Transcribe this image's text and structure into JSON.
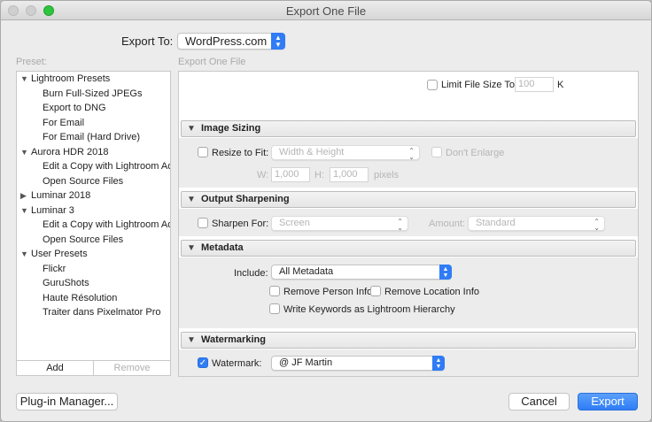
{
  "window": {
    "title": "Export One File"
  },
  "export_to": {
    "label": "Export To:",
    "value": "WordPress.com"
  },
  "presets": {
    "heading": "Preset:",
    "items": [
      {
        "type": "folder",
        "expanded": true,
        "label": "Lightroom Presets"
      },
      {
        "type": "child",
        "label": "Burn Full-Sized JPEGs"
      },
      {
        "type": "child",
        "label": "Export to DNG"
      },
      {
        "type": "child",
        "label": "For Email"
      },
      {
        "type": "child",
        "label": "For Email (Hard Drive)"
      },
      {
        "type": "folder",
        "expanded": true,
        "label": "Aurora HDR 2018"
      },
      {
        "type": "child",
        "label": "Edit a Copy with Lightroom Adju"
      },
      {
        "type": "child",
        "label": "Open Source Files"
      },
      {
        "type": "folder",
        "expanded": false,
        "label": "Luminar 2018"
      },
      {
        "type": "folder",
        "expanded": true,
        "label": "Luminar 3"
      },
      {
        "type": "child",
        "label": "Edit a Copy with Lightroom Adju"
      },
      {
        "type": "child",
        "label": "Open Source Files"
      },
      {
        "type": "folder",
        "expanded": true,
        "label": "User Presets"
      },
      {
        "type": "child",
        "label": "Flickr"
      },
      {
        "type": "child",
        "label": "GuruShots"
      },
      {
        "type": "child",
        "label": "Haute Résolution"
      },
      {
        "type": "child",
        "label": "Traiter dans Pixelmator Pro"
      }
    ],
    "add_label": "Add",
    "remove_label": "Remove"
  },
  "export_panel": {
    "heading": "Export One File",
    "limit": {
      "label": "Limit File Size To:",
      "value": "100",
      "unit": "K"
    },
    "image_sizing": {
      "title": "Image Sizing",
      "resize_label": "Resize to Fit:",
      "resize_mode": "Width & Height",
      "dont_enlarge": "Don't Enlarge",
      "w_label": "W:",
      "w_value": "1,000",
      "h_label": "H:",
      "h_value": "1,000",
      "unit": "pixels"
    },
    "output_sharpening": {
      "title": "Output Sharpening",
      "sharpen_label": "Sharpen For:",
      "sharpen_value": "Screen",
      "amount_label": "Amount:",
      "amount_value": "Standard"
    },
    "metadata": {
      "title": "Metadata",
      "include_label": "Include:",
      "include_value": "All Metadata",
      "remove_person": "Remove Person Info",
      "remove_location": "Remove Location Info",
      "write_keywords": "Write Keywords as Lightroom Hierarchy"
    },
    "watermarking": {
      "title": "Watermarking",
      "watermark_label": "Watermark:",
      "watermark_value": "@ JF Martin",
      "checked": true
    }
  },
  "footer": {
    "plugin_manager": "Plug-in Manager...",
    "cancel": "Cancel",
    "export": "Export"
  },
  "colors": {
    "accent": "#2f7cf6",
    "window_bg": "#ececec"
  }
}
